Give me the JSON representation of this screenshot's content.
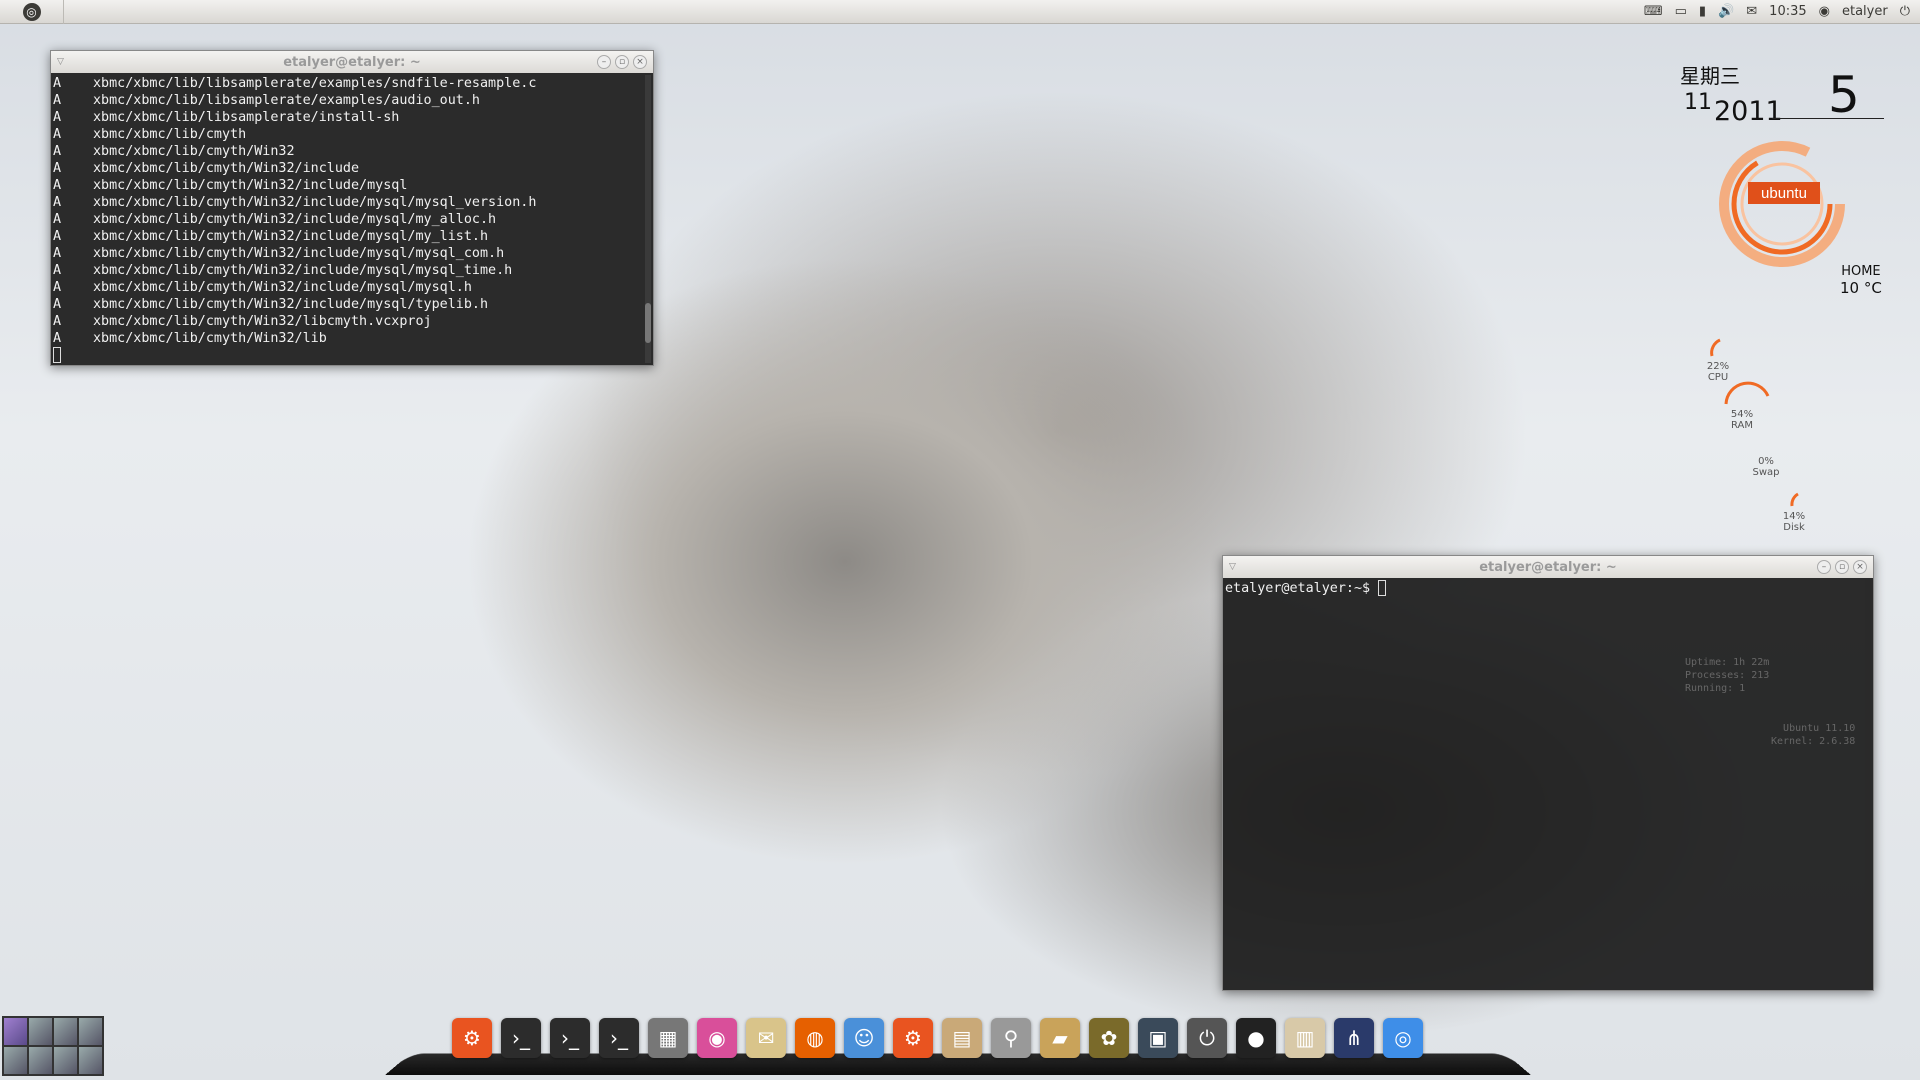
{
  "top_panel": {
    "bfb_icon": "ubuntu-logo",
    "time": "10:35",
    "user": "etalyer",
    "indicators": [
      "keyboard-icon",
      "battery-icon",
      "network-icon",
      "volume-icon",
      "mail-icon"
    ]
  },
  "terminal1": {
    "title": "etalyer@etalyer: ~",
    "lines": [
      {
        "flag": "A",
        "path": "xbmc/xbmc/lib/libsamplerate/examples/sndfile-resample.c"
      },
      {
        "flag": "A",
        "path": "xbmc/xbmc/lib/libsamplerate/examples/audio_out.h"
      },
      {
        "flag": "A",
        "path": "xbmc/xbmc/lib/libsamplerate/install-sh"
      },
      {
        "flag": "A",
        "path": "xbmc/xbmc/lib/cmyth"
      },
      {
        "flag": "A",
        "path": "xbmc/xbmc/lib/cmyth/Win32"
      },
      {
        "flag": "A",
        "path": "xbmc/xbmc/lib/cmyth/Win32/include"
      },
      {
        "flag": "A",
        "path": "xbmc/xbmc/lib/cmyth/Win32/include/mysql"
      },
      {
        "flag": "A",
        "path": "xbmc/xbmc/lib/cmyth/Win32/include/mysql/mysql_version.h"
      },
      {
        "flag": "A",
        "path": "xbmc/xbmc/lib/cmyth/Win32/include/mysql/my_alloc.h"
      },
      {
        "flag": "A",
        "path": "xbmc/xbmc/lib/cmyth/Win32/include/mysql/my_list.h"
      },
      {
        "flag": "A",
        "path": "xbmc/xbmc/lib/cmyth/Win32/include/mysql/mysql_com.h"
      },
      {
        "flag": "A",
        "path": "xbmc/xbmc/lib/cmyth/Win32/include/mysql/mysql_time.h"
      },
      {
        "flag": "A",
        "path": "xbmc/xbmc/lib/cmyth/Win32/include/mysql/mysql.h"
      },
      {
        "flag": "A",
        "path": "xbmc/xbmc/lib/cmyth/Win32/include/mysql/typelib.h"
      },
      {
        "flag": "A",
        "path": "xbmc/xbmc/lib/cmyth/Win32/libcmyth.vcxproj"
      },
      {
        "flag": "A",
        "path": "xbmc/xbmc/lib/cmyth/Win32/lib"
      }
    ]
  },
  "terminal2": {
    "title": "etalyer@etalyer: ~",
    "prompt": "etalyer@etalyer:~$"
  },
  "clock": {
    "weekday": "星期三",
    "month": "11",
    "year": "2011",
    "day": "5"
  },
  "ubuntu_badge": "ubuntu",
  "weather": {
    "location": "HOME",
    "temperature": "10 °C"
  },
  "gauges": [
    {
      "label": "CPU",
      "value": "22%"
    },
    {
      "label": "RAM",
      "value": "54%"
    },
    {
      "label": "Swap",
      "value": "0%"
    },
    {
      "label": "Disk",
      "value": "14%"
    }
  ],
  "conky": {
    "uptime": "Uptime: 1h 22m",
    "processes": "Processes: 213",
    "running": "Running: 1",
    "os": "Ubuntu 11.10",
    "kernel": "Kernel: 2.6.38"
  },
  "dock": [
    {
      "name": "ubuntu-software-icon",
      "color": "#e95420",
      "glyph": "⚙"
    },
    {
      "name": "terminal-icon-1",
      "color": "#2c2c2c",
      "glyph": "›_"
    },
    {
      "name": "terminal-icon-2",
      "color": "#2c2c2c",
      "glyph": "›_"
    },
    {
      "name": "terminal-icon-3",
      "color": "#2c2c2c",
      "glyph": "›_"
    },
    {
      "name": "calculator-icon",
      "color": "#777777",
      "glyph": "▦"
    },
    {
      "name": "color-picker-icon",
      "color": "#d94f9a",
      "glyph": "◉"
    },
    {
      "name": "mail-icon",
      "color": "#d9c48a",
      "glyph": "✉"
    },
    {
      "name": "firefox-icon",
      "color": "#e66000",
      "glyph": "◍"
    },
    {
      "name": "chat-icon",
      "color": "#4a90d9",
      "glyph": "☺"
    },
    {
      "name": "ubuntu-one-icon",
      "color": "#e95420",
      "glyph": "⚙"
    },
    {
      "name": "text-editor-icon",
      "color": "#c9a978",
      "glyph": "▤"
    },
    {
      "name": "search-icon",
      "color": "#999999",
      "glyph": "⚲"
    },
    {
      "name": "files-icon",
      "color": "#c9a35a",
      "glyph": "▰"
    },
    {
      "name": "photos-icon",
      "color": "#7a6a2a",
      "glyph": "✿"
    },
    {
      "name": "workspace-switcher-icon",
      "color": "#3a4a5a",
      "glyph": "▣"
    },
    {
      "name": "power-icon",
      "color": "#555555",
      "glyph": "⏻"
    },
    {
      "name": "recorder-icon",
      "color": "#222222",
      "glyph": "●"
    },
    {
      "name": "document-viewer-icon",
      "color": "#d8c9a8",
      "glyph": "▥"
    },
    {
      "name": "wireless-icon",
      "color": "#2a3a6a",
      "glyph": "⋔"
    },
    {
      "name": "chrome-icon",
      "color": "#3e8ee8",
      "glyph": "◎"
    }
  ]
}
